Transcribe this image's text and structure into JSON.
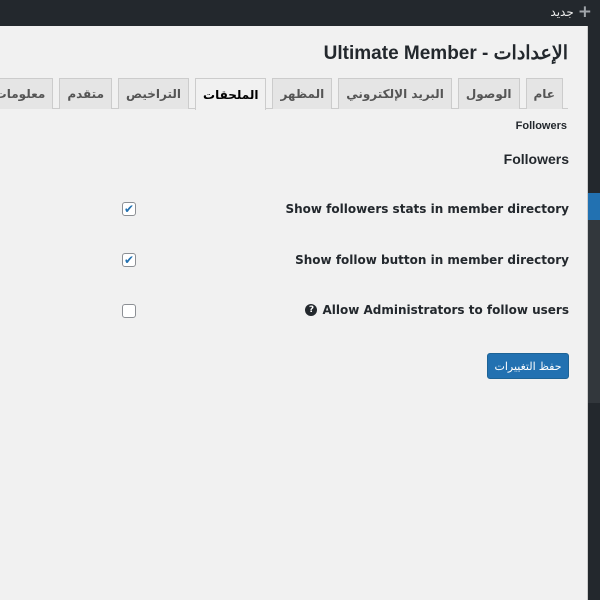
{
  "adminbar": {
    "new_label": "جديد"
  },
  "page": {
    "title": "Ultimate Member - الإعدادات"
  },
  "tabs": [
    {
      "label": "عام",
      "active": false
    },
    {
      "label": "الوصول",
      "active": false
    },
    {
      "label": "البريد الإلكتروني",
      "active": false
    },
    {
      "label": "المظهر",
      "active": false
    },
    {
      "label": "الملحقات",
      "active": true
    },
    {
      "label": "التراخيص",
      "active": false
    },
    {
      "label": "متقدم",
      "active": false
    },
    {
      "label": "معلومات ا",
      "active": false
    }
  ],
  "subnav": {
    "current": "Followers"
  },
  "section": {
    "title": "Followers"
  },
  "options": [
    {
      "label": "Show followers stats in member directory",
      "checked": true
    },
    {
      "label": "Show follow button in member directory",
      "checked": true
    },
    {
      "label": "Allow Administrators to follow users",
      "checked": false,
      "help": true
    }
  ],
  "save_label": "حفظ التغييرات"
}
